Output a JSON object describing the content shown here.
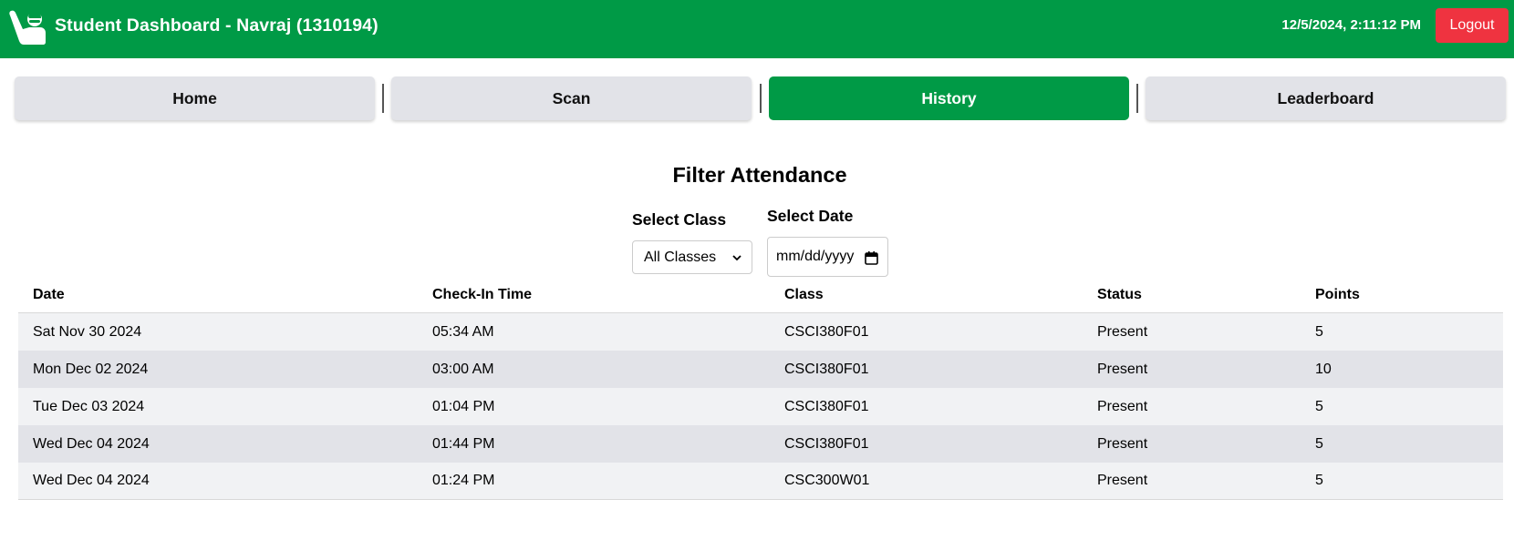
{
  "header": {
    "title": "Student Dashboard - Navraj (1310194)",
    "datetime": "12/5/2024, 2:11:12 PM",
    "logout_label": "Logout",
    "logo_icon": "student-raising-hand-icon",
    "bg_color": "#009a46"
  },
  "tabs": [
    {
      "label": "Home",
      "active": false
    },
    {
      "label": "Scan",
      "active": false
    },
    {
      "label": "History",
      "active": true
    },
    {
      "label": "Leaderboard",
      "active": false
    }
  ],
  "filter": {
    "title": "Filter Attendance",
    "class_label": "Select Class",
    "class_value": "All Classes",
    "date_label": "Select Date",
    "date_placeholder": "mm/dd/yyyy"
  },
  "table": {
    "headers": [
      "Date",
      "Check-In Time",
      "Class",
      "Status",
      "Points"
    ],
    "rows": [
      [
        "Sat Nov 30 2024",
        "05:34 AM",
        "CSCI380F01",
        "Present",
        "5"
      ],
      [
        "Mon Dec 02 2024",
        "03:00 AM",
        "CSCI380F01",
        "Present",
        "10"
      ],
      [
        "Tue Dec 03 2024",
        "01:04 PM",
        "CSCI380F01",
        "Present",
        "5"
      ],
      [
        "Wed Dec 04 2024",
        "01:44 PM",
        "CSCI380F01",
        "Present",
        "5"
      ],
      [
        "Wed Dec 04 2024",
        "01:24 PM",
        "CSC300W01",
        "Present",
        "5"
      ]
    ]
  }
}
